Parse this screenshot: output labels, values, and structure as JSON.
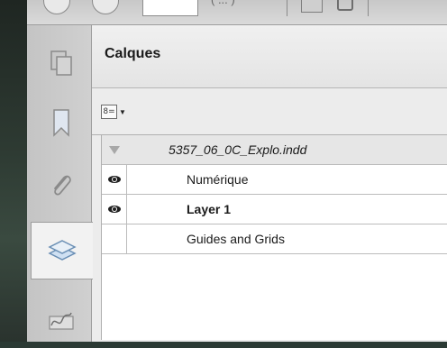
{
  "panel": {
    "title": "Calques",
    "options_icon": "list-options-icon"
  },
  "layers": {
    "document": {
      "name": "5357_06_0C_Explo.indd",
      "expanded": true
    },
    "items": [
      {
        "name": "Numérique",
        "visible": true,
        "bold": false
      },
      {
        "name": "Layer 1",
        "visible": true,
        "bold": true
      },
      {
        "name": "Guides and Grids",
        "visible": false,
        "bold": false
      }
    ]
  },
  "side_tabs": [
    {
      "icon": "pages-icon",
      "active": false
    },
    {
      "icon": "bookmark-icon",
      "active": false
    },
    {
      "icon": "paperclip-icon",
      "active": false
    },
    {
      "icon": "layers-icon",
      "active": true
    },
    {
      "icon": "signature-icon",
      "active": false
    }
  ],
  "colors": {
    "panel_bg": "#ececec",
    "list_bg": "#ffffff",
    "active_tab_bg": "#f2f2f2",
    "icon_gray": "#8a8a8a"
  }
}
